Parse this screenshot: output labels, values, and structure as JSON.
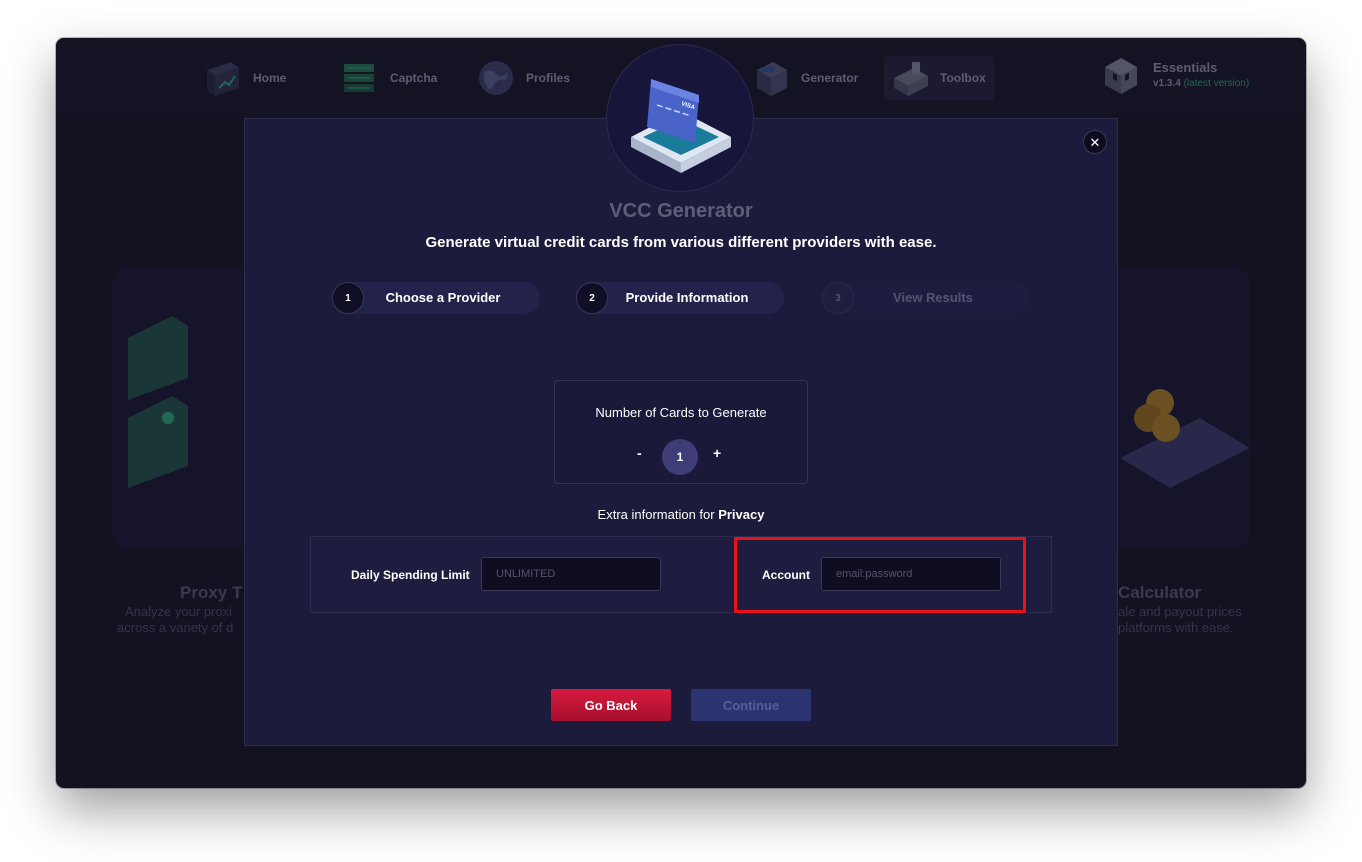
{
  "window": {
    "traffic_lights": [
      "close",
      "minimize",
      "zoom"
    ]
  },
  "nav": {
    "items": [
      {
        "label": "Home",
        "icon": "home-icon"
      },
      {
        "label": "Captcha",
        "icon": "captcha-icon"
      },
      {
        "label": "Profiles",
        "icon": "profiles-icon"
      },
      {
        "label": "Generator",
        "icon": "generator-icon"
      },
      {
        "label": "Toolbox",
        "icon": "toolbox-icon"
      }
    ],
    "essentials": {
      "title": "Essentials",
      "version": "v1.3.4",
      "version_note": "(latest version)",
      "icon": "cube-icon"
    }
  },
  "background": {
    "left_card": {
      "title": "Proxy T",
      "text_line1": "Analyze your proxi",
      "text_line2": "across a variety of d"
    },
    "right_card": {
      "title": "Calculator",
      "text_line1": "ale and payout prices",
      "text_line2": "platforms with ease."
    }
  },
  "modal": {
    "icon": "credit-card-icon",
    "title": "VCC Generator",
    "subtitle": "Generate virtual credit cards from various different providers with ease.",
    "close_icon": "close-icon",
    "close_glyph": "✕",
    "steps": [
      {
        "num": "1",
        "label": "Choose a Provider",
        "state": "done"
      },
      {
        "num": "2",
        "label": "Provide Information",
        "state": "active"
      },
      {
        "num": "3",
        "label": "View Results",
        "state": "inactive"
      }
    ],
    "count": {
      "label": "Number of Cards to Generate",
      "minus": "-",
      "value": "1",
      "plus": "+"
    },
    "extra": {
      "prefix": "Extra information for ",
      "provider": "Privacy"
    },
    "fields": {
      "spending": {
        "label": "Daily Spending Limit",
        "placeholder": "UNLIMITED"
      },
      "account": {
        "label": "Account",
        "placeholder": "email:password"
      }
    },
    "buttons": {
      "back": "Go Back",
      "continue": "Continue"
    }
  },
  "colors": {
    "accent_red": "#d61b3f",
    "highlight": "#e8121b",
    "modal_bg": "#1c1b3b"
  }
}
